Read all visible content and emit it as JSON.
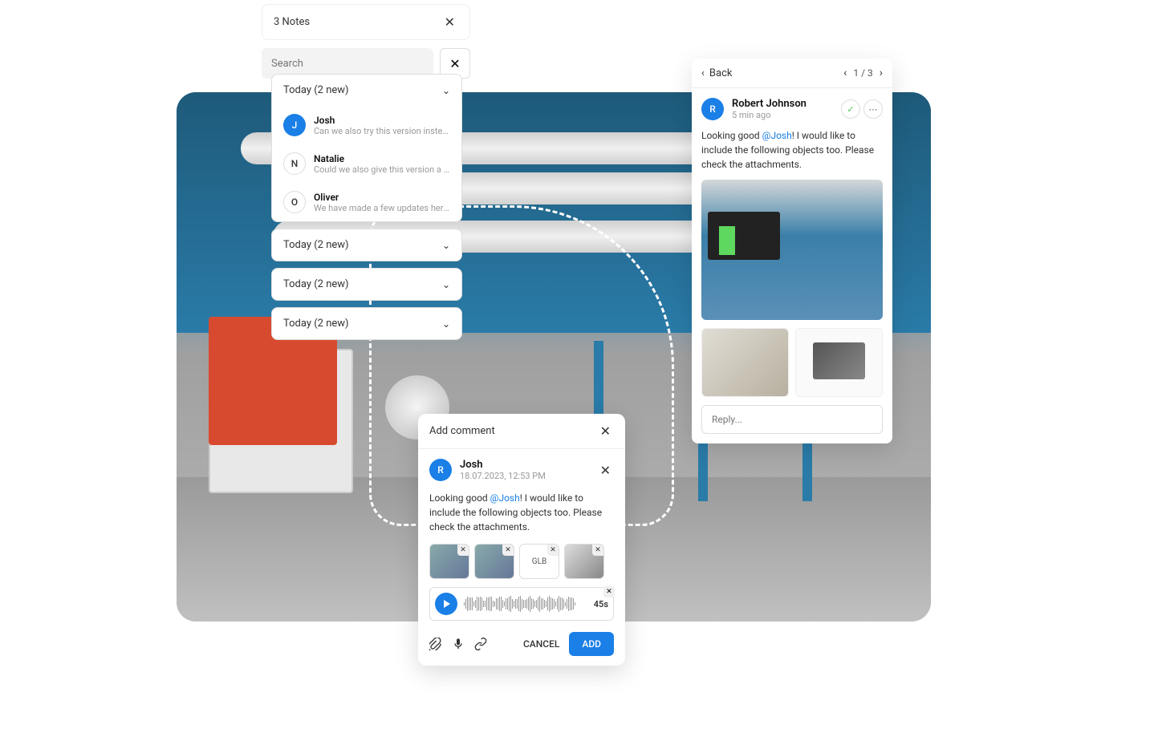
{
  "notes": {
    "title": "3 Notes",
    "search_placeholder": "Search",
    "groups": [
      {
        "label": "Today (2 new)",
        "expanded": true,
        "items": [
          {
            "initial": "J",
            "avatar_style": "blue",
            "name": "Josh",
            "preview": "Can we also try this version instead ..."
          },
          {
            "initial": "N",
            "avatar_style": "outline",
            "name": "Natalie",
            "preview": "Could we also give this version a try ..."
          },
          {
            "initial": "O",
            "avatar_style": "outline",
            "name": "Oliver",
            "preview": "We have made a few updates here ..."
          }
        ]
      },
      {
        "label": "Today (2 new)",
        "expanded": false
      },
      {
        "label": "Today (2 new)",
        "expanded": false
      },
      {
        "label": "Today (2 new)",
        "expanded": false
      }
    ]
  },
  "add_comment": {
    "title": "Add comment",
    "author": {
      "initial": "R",
      "name": "Josh",
      "timestamp": "18.07.2023, 12:53 PM"
    },
    "text_before": "Looking good ",
    "mention": "@Josh",
    "text_after": "! I would like to include the following objects too. Please check the attachments.",
    "attachments": [
      {
        "type": "image"
      },
      {
        "type": "image"
      },
      {
        "type": "glb",
        "label": "GLB"
      },
      {
        "type": "bw"
      }
    ],
    "audio_duration": "45s",
    "cancel_label": "CANCEL",
    "add_label": "ADD"
  },
  "detail": {
    "back_label": "Back",
    "pagination": "1 / 3",
    "author": {
      "initial": "R",
      "name": "Robert Johnson",
      "timestamp": "5 min ago"
    },
    "text_before": "Looking good ",
    "mention": "@Josh",
    "text_after": "! I would like to include the following objects too. Please check the attachments.",
    "reply_placeholder": "Reply..."
  }
}
